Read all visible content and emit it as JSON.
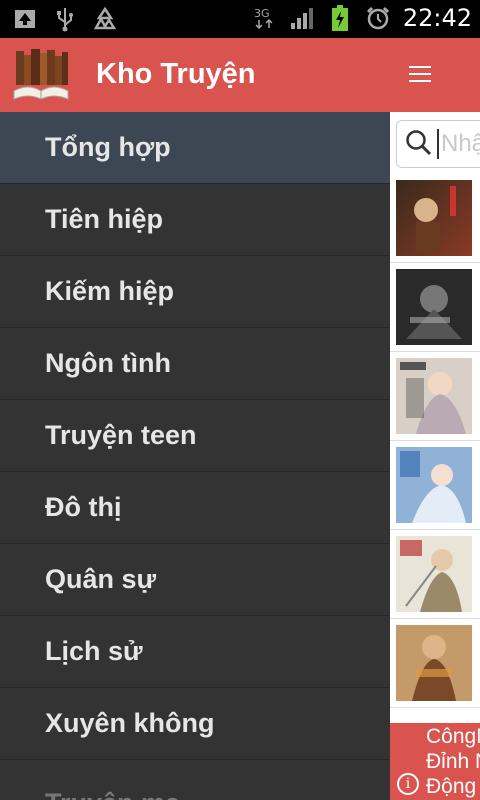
{
  "status_bar": {
    "time": "22:42",
    "network": "3G",
    "icons": [
      "screenshot-icon",
      "usb-icon",
      "recycle-icon",
      "3g-icon",
      "signal-icon",
      "battery-icon",
      "alarm-icon"
    ]
  },
  "action_bar": {
    "title": "Kho Truyện",
    "color": "#d9534f"
  },
  "drawer": {
    "items": [
      {
        "label": "Tổng hợp"
      },
      {
        "label": "Tiên hiệp"
      },
      {
        "label": "Kiếm hiệp"
      },
      {
        "label": "Ngôn tình"
      },
      {
        "label": "Truyện teen"
      },
      {
        "label": "Đô thị"
      },
      {
        "label": "Quân sự"
      },
      {
        "label": "Lịch sử"
      },
      {
        "label": "Xuyên không"
      },
      {
        "label": "Truyện ma"
      }
    ],
    "active_index": 0
  },
  "content": {
    "search": {
      "placeholder": "Nhậ"
    },
    "thumbnails": [
      "book-cover-1",
      "book-cover-2",
      "book-cover-3",
      "book-cover-4",
      "book-cover-5",
      "book-cover-6"
    ]
  },
  "ad": {
    "lines": [
      "CôngN",
      "Đỉnh N",
      "Động"
    ]
  }
}
